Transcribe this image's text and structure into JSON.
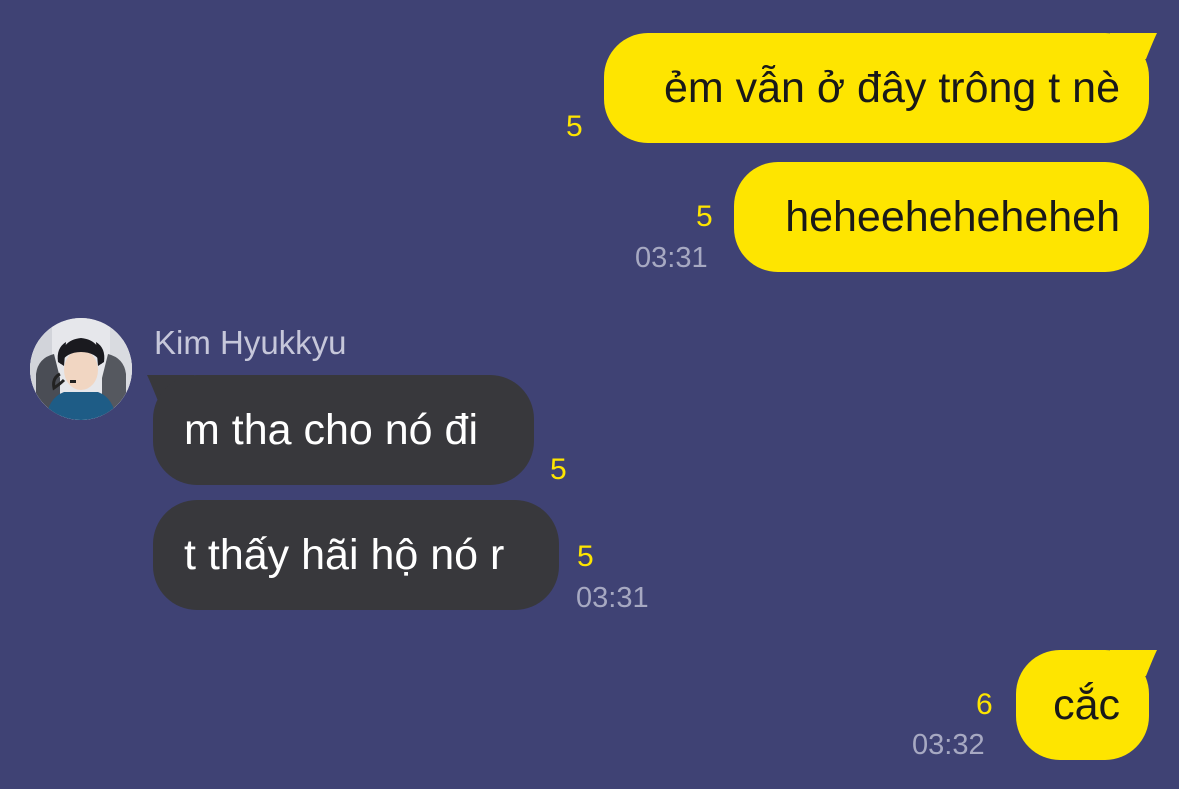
{
  "theme": {
    "background": "#3F4274",
    "outgoing_bubble": "#FEE500",
    "incoming_bubble": "#38383C",
    "unread_count_color": "#FEE500",
    "timestamp_color": "#A7A9C2"
  },
  "messages": [
    {
      "direction": "outgoing",
      "text": "ẻm vẫn ở đây trông t nè",
      "unread": "5",
      "time": ""
    },
    {
      "direction": "outgoing",
      "text": "heheeheheheheh",
      "unread": "5",
      "time": "03:31"
    },
    {
      "direction": "incoming",
      "sender": "Kim Hyukkyu",
      "avatar_icon": "profile-photo",
      "text": "m tha cho nó đi",
      "unread": "5",
      "time": ""
    },
    {
      "direction": "incoming",
      "text": "t thấy hãi hộ nó r",
      "unread": "5",
      "time": "03:31"
    },
    {
      "direction": "outgoing",
      "text": "cắc",
      "unread": "6",
      "time": "03:32"
    }
  ]
}
